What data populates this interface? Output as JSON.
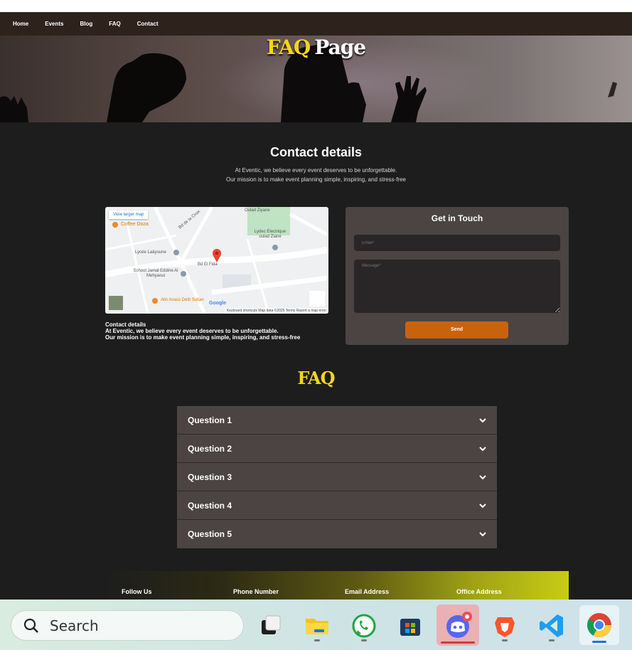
{
  "nav": {
    "items": [
      "Home",
      "Events",
      "Blog",
      "FAQ",
      "Contact"
    ]
  },
  "hero": {
    "title_part1": "FAQ",
    "title_part2": "Page"
  },
  "contact": {
    "title": "Contact details",
    "line1": "At Eventic, we believe every event deserves to be unforgettable.",
    "line2": "Our mission is to make event planning simple, inspiring, and stress-free",
    "details_heading": "Contact details"
  },
  "map": {
    "view_larger": "View larger map",
    "places": [
      "Coffee Doza",
      "Lycée Laâyoune",
      "School Jamal Eddine Al Mehyaoui",
      "Lydec Electrique oulad Ziane",
      "Oulad Ziyane",
      "Allo Anass Deib Sultan",
      "Bd El Fida",
      "Bd de la Croix"
    ],
    "footer": "Keyboard shortcuts   Map data ©2025   Terms   Report a map error",
    "google": "Google"
  },
  "form": {
    "title": "Get in Touch",
    "email_placeholder": "Email*",
    "message_placeholder": "Message*",
    "send_label": "Send"
  },
  "faq": {
    "title": "FAQ",
    "questions": [
      "Question 1",
      "Question 2",
      "Question 3",
      "Question 4",
      "Question 5"
    ]
  },
  "footer": {
    "follow": "Follow Us",
    "phone": "Phone Number",
    "email": "Email Address",
    "office": "Office Address"
  },
  "taskbar": {
    "search_placeholder": "Search"
  },
  "colors": {
    "accent_orange": "#c8630d",
    "title_yellow": "#f3d61c",
    "panel": "#4b4443",
    "background": "#1d1d1d"
  }
}
